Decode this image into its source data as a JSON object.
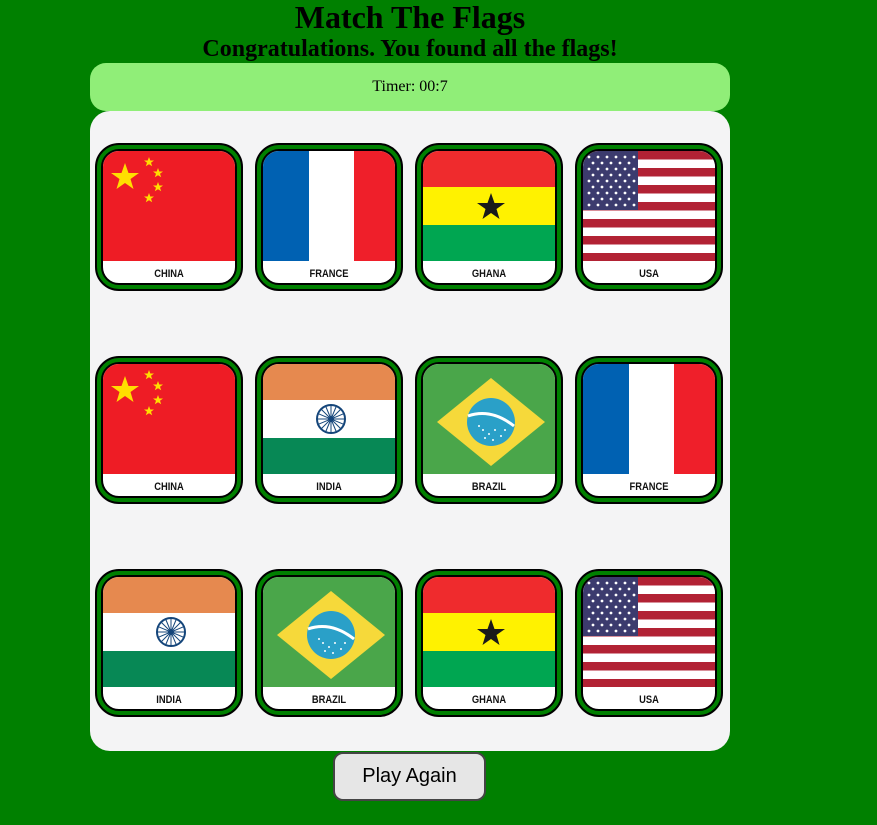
{
  "header": {
    "title": "Match The Flags",
    "message": "Congratulations. You found all the flags!"
  },
  "timer": {
    "text": "Timer: 00:7"
  },
  "board": {
    "cards": [
      {
        "country": "CHINA"
      },
      {
        "country": "FRANCE"
      },
      {
        "country": "GHANA"
      },
      {
        "country": "USA"
      },
      {
        "country": "CHINA"
      },
      {
        "country": "INDIA"
      },
      {
        "country": "BRAZIL"
      },
      {
        "country": "FRANCE"
      },
      {
        "country": "INDIA"
      },
      {
        "country": "BRAZIL"
      },
      {
        "country": "GHANA"
      },
      {
        "country": "USA"
      }
    ]
  },
  "actions": {
    "play_again_label": "Play Again"
  },
  "colors": {
    "page_background": "#008000",
    "timer_background": "#90ee78",
    "board_background": "#f4f4f5"
  }
}
